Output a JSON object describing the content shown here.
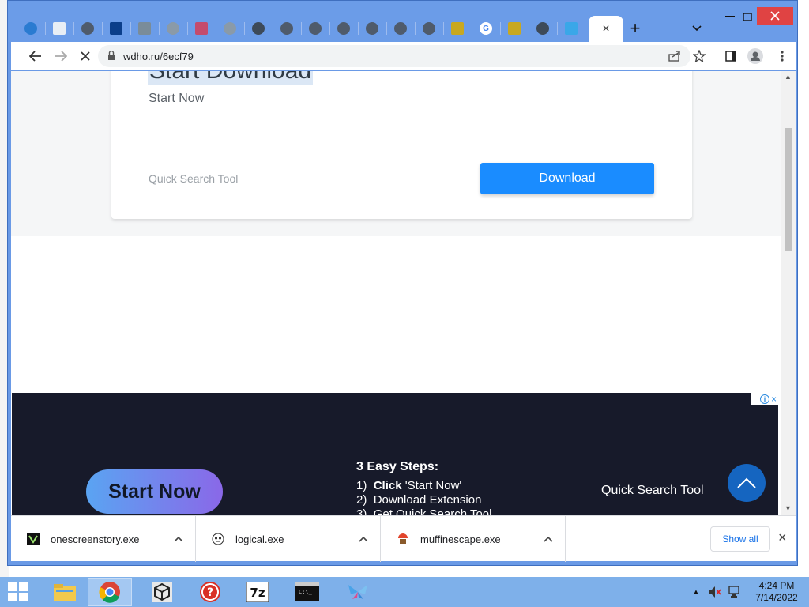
{
  "browser": {
    "active_tab_close": "×",
    "new_tab": "+",
    "address": "wdho.ru/6ecf79"
  },
  "page": {
    "card_title": "Start Download",
    "card_subtitle": "Start Now",
    "card_tool_name": "Quick Search Tool",
    "download_button": "Download"
  },
  "ad": {
    "badge_info": "i",
    "badge_close": "×",
    "start_button": "Start Now",
    "steps_title": "3 Easy Steps:",
    "steps": [
      {
        "num": "1)",
        "bold": "Click",
        "text": " 'Start Now'"
      },
      {
        "num": "2)",
        "bold": "",
        "text": "Download Extension"
      },
      {
        "num": "3)",
        "bold": "",
        "text": "Get Quick Search Tool"
      }
    ],
    "tool_name": "Quick Search Tool"
  },
  "downloads": {
    "items": [
      {
        "name": "onescreenstory.exe"
      },
      {
        "name": "logical.exe"
      },
      {
        "name": "muffinescape.exe"
      }
    ],
    "show_all": "Show all",
    "close": "×"
  },
  "taskbar": {
    "time": "4:24 PM",
    "date": "7/14/2022"
  },
  "colors": {
    "titlebar": "#6b9ce8",
    "download_button": "#1a8cff",
    "ad_background": "#171a2a",
    "taskbar": "#7eb0ea"
  }
}
